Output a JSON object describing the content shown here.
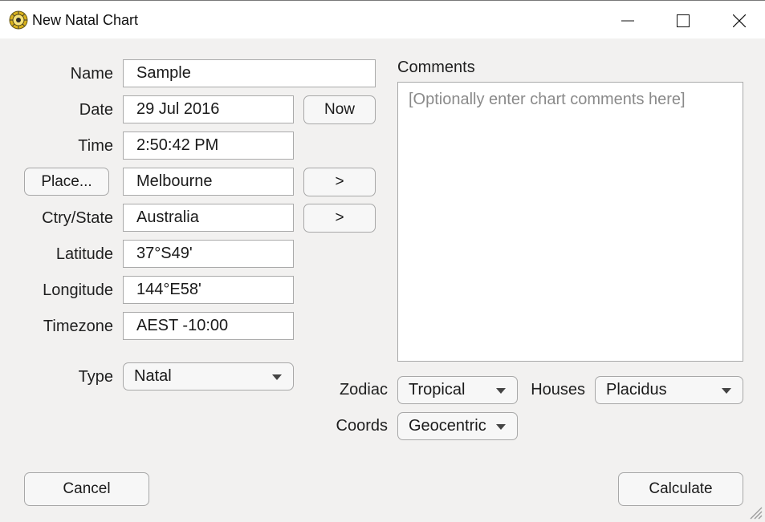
{
  "window": {
    "title": "New Natal Chart"
  },
  "form": {
    "name": {
      "label": "Name",
      "value": "Sample"
    },
    "date": {
      "label": "Date",
      "value": "29 Jul 2016"
    },
    "time": {
      "label": "Time",
      "value": "2:50:42 PM"
    },
    "place": {
      "button_label": "Place...",
      "value": "Melbourne"
    },
    "country": {
      "label": "Ctry/State",
      "value": "Australia"
    },
    "latitude": {
      "label": "Latitude",
      "value": "37°S49'"
    },
    "longitude": {
      "label": "Longitude",
      "value": "144°E58'"
    },
    "timezone": {
      "label": "Timezone",
      "value": "AEST -10:00"
    },
    "type": {
      "label": "Type",
      "value": "Natal"
    },
    "now_button": "Now",
    "place_next_button": ">",
    "country_next_button": ">"
  },
  "comments": {
    "label": "Comments",
    "placeholder": "[Optionally enter chart comments here]"
  },
  "options": {
    "zodiac": {
      "label": "Zodiac",
      "value": "Tropical"
    },
    "houses": {
      "label": "Houses",
      "value": "Placidus"
    },
    "coords": {
      "label": "Coords",
      "value": "Geocentric"
    }
  },
  "footer": {
    "cancel": "Cancel",
    "calculate": "Calculate"
  },
  "icons": {
    "app": "zodiac-wheel-icon",
    "minimize": "minimize-icon",
    "maximize": "maximize-icon",
    "close": "close-icon",
    "dropdown": "chevron-down-icon",
    "resize": "resize-grip-icon"
  },
  "colors": {
    "window_bg": "#f2f1f0",
    "field_bg": "#ffffff",
    "placeholder": "#8a8a8a",
    "icon_gold": "#d9b21c"
  }
}
